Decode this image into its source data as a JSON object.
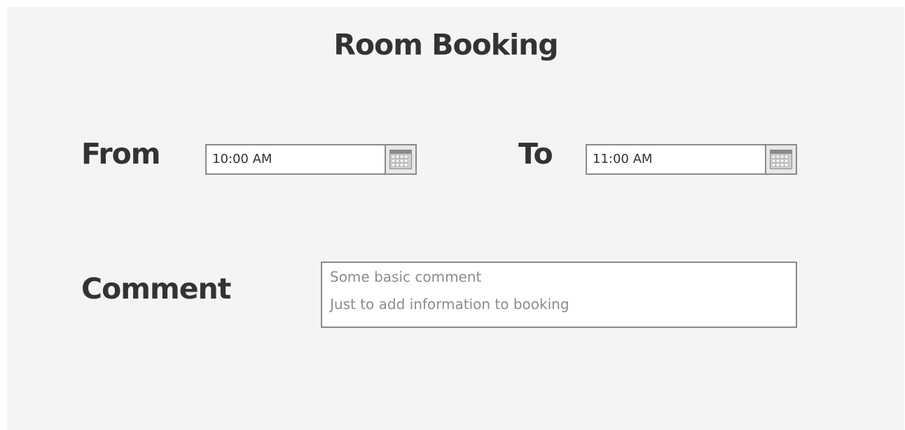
{
  "form": {
    "title": "Room Booking",
    "from_label": "From",
    "to_label": "To",
    "comment_label": "Comment"
  },
  "from_field": {
    "value": "10:00 AM",
    "icon": "calendar-icon"
  },
  "to_field": {
    "value": "11:00 AM",
    "icon": "calendar-icon"
  },
  "comment": {
    "lines": [
      "Some basic comment",
      "Just to add information to booking"
    ]
  },
  "colors": {
    "background": "#f4f4f4",
    "text": "#333333",
    "border": "#8a8a8a",
    "placeholder_text": "#8c8c8c"
  }
}
